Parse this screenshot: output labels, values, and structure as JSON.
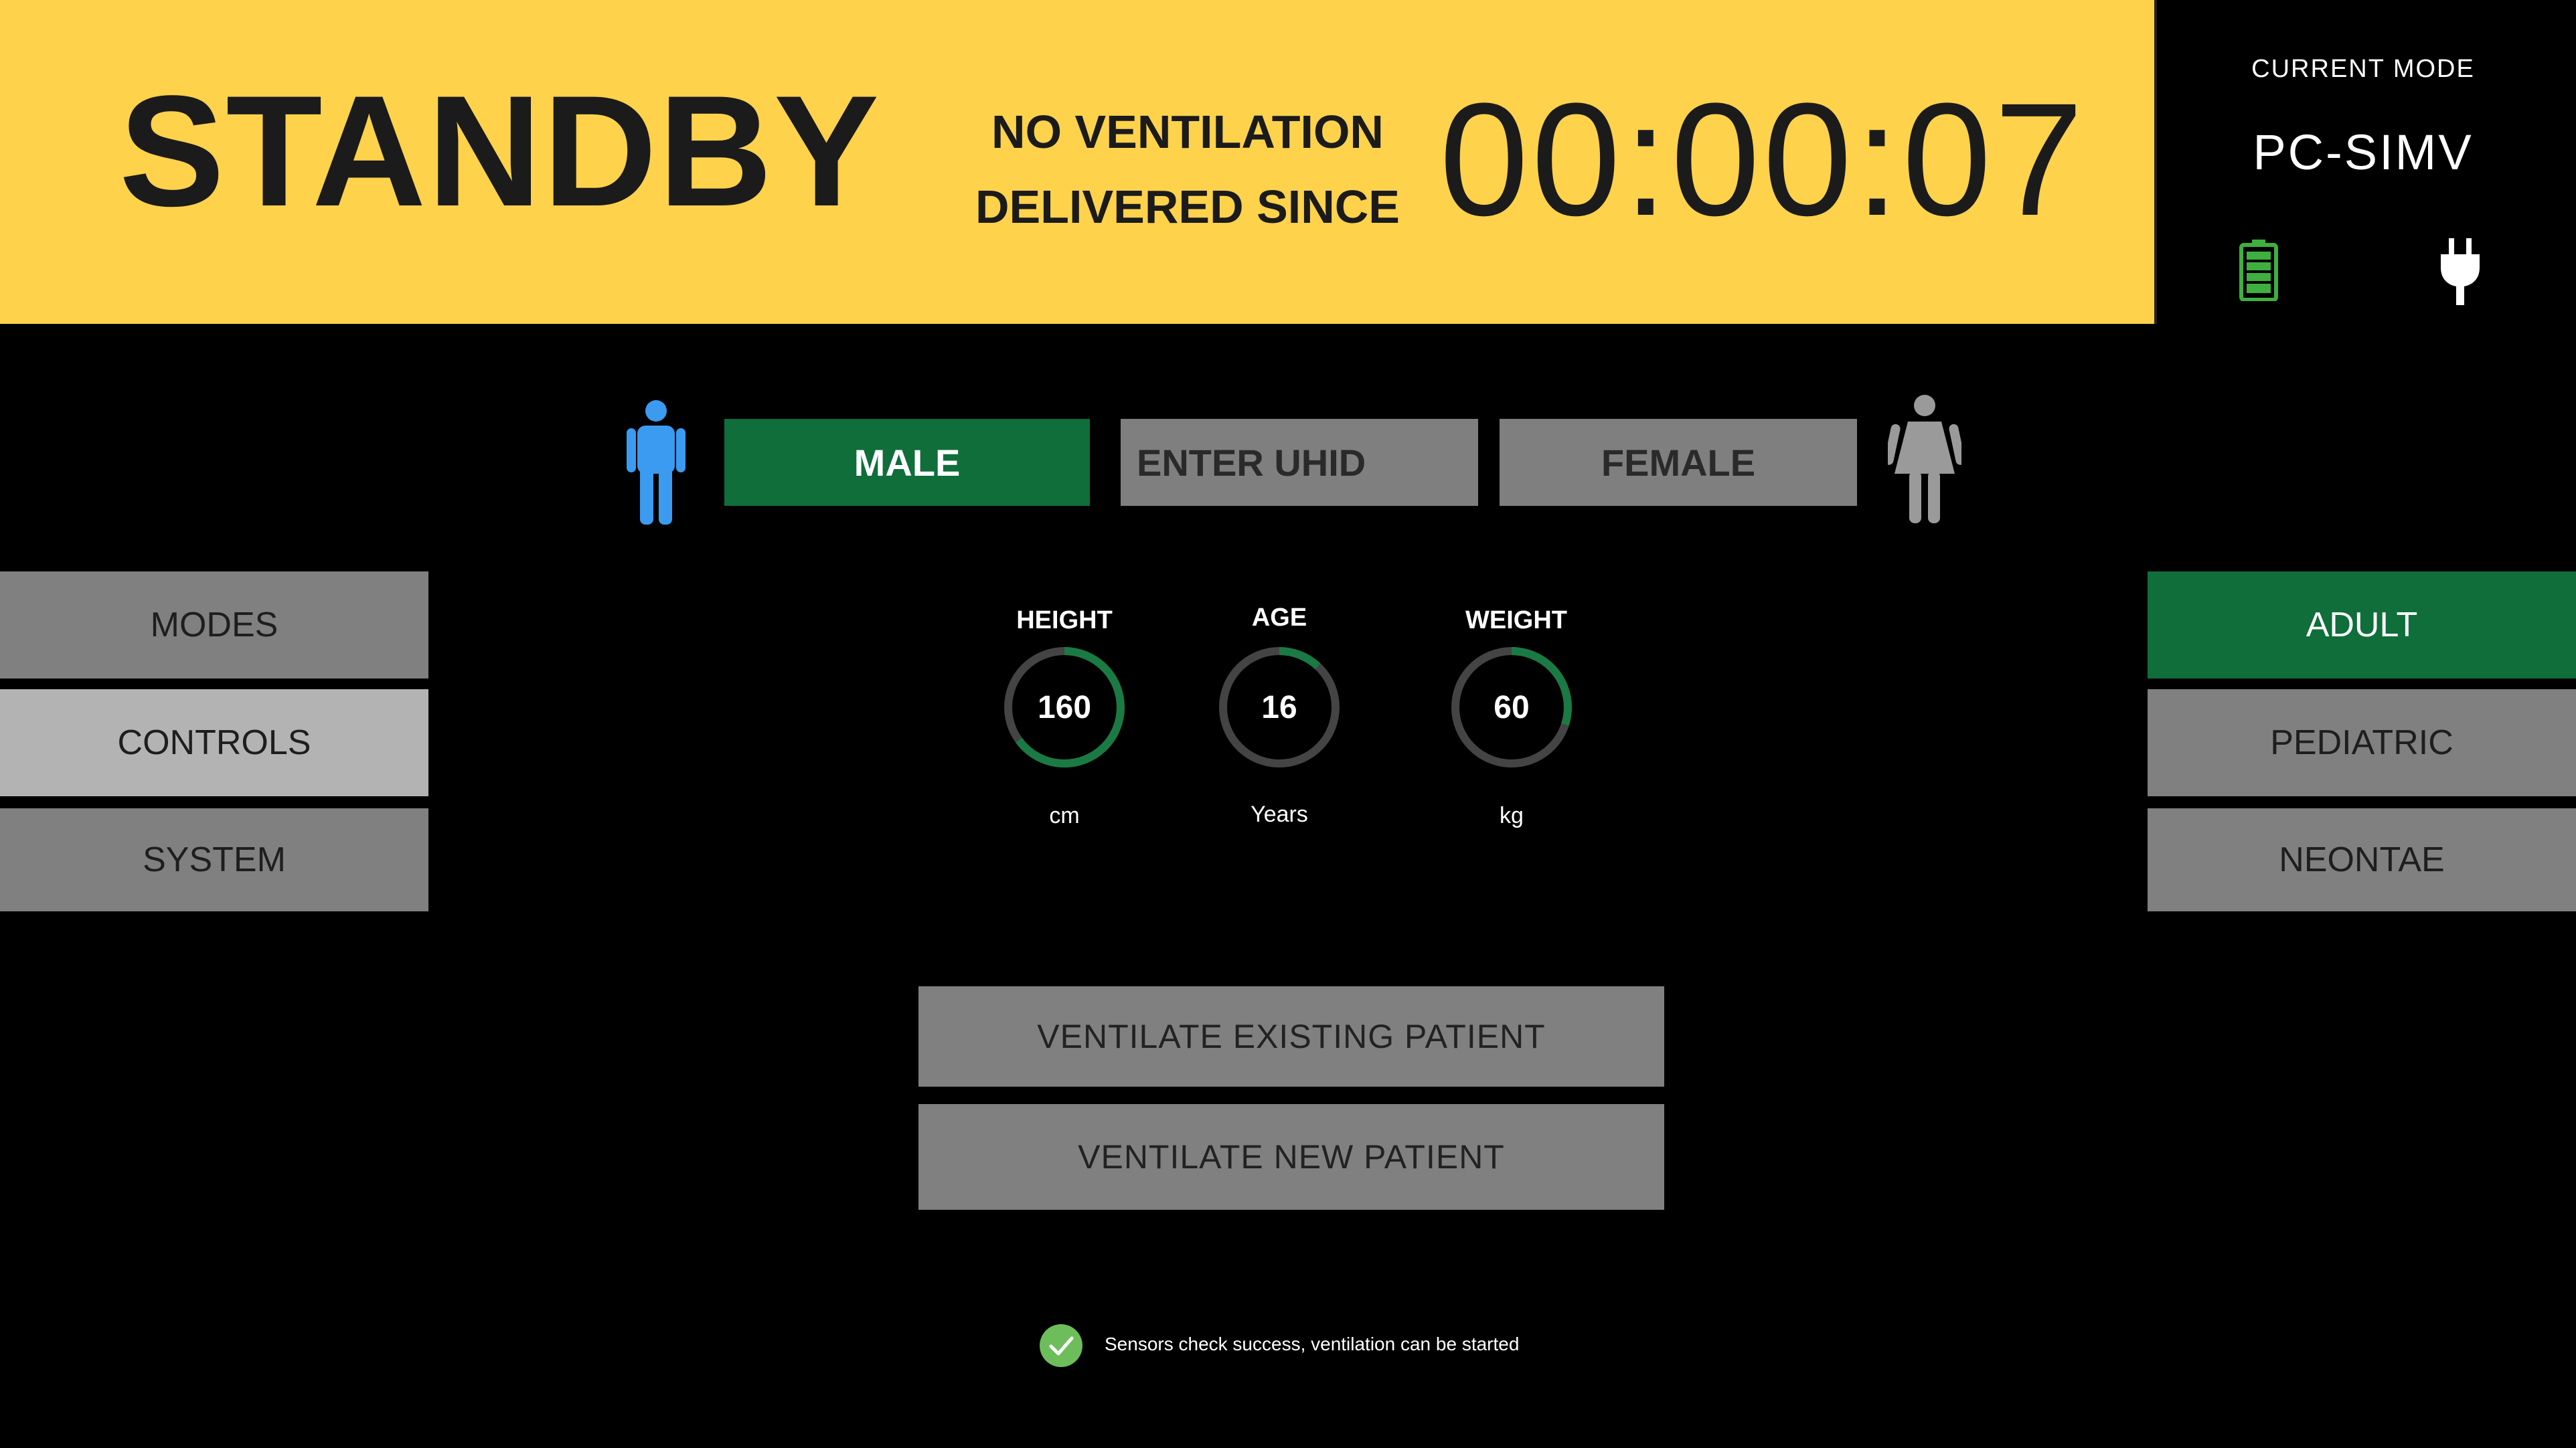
{
  "header": {
    "status": "STANDBY",
    "no_vent_line1": "NO VENTILATION",
    "no_vent_line2": "DELIVERED SINCE",
    "elapsed": "00:00:07",
    "banner_color": "#FFD24C"
  },
  "mode_panel": {
    "label": "CURRENT MODE",
    "value": "PC-SIMV",
    "battery_icon": "battery-full-icon",
    "power_icon": "power-plug-icon",
    "battery_color": "#3FAF3F"
  },
  "patient": {
    "male_label": "MALE",
    "uhid_placeholder": "ENTER UHID",
    "female_label": "FEMALE",
    "selected_gender": "MALE",
    "male_icon_color": "#3A9BF0",
    "female_icon_color": "#9a9a9a"
  },
  "left_nav": {
    "items": [
      {
        "label": "MODES"
      },
      {
        "label": "CONTROLS",
        "active": true
      },
      {
        "label": "SYSTEM"
      }
    ]
  },
  "right_nav": {
    "items": [
      {
        "label": "ADULT",
        "selected": true
      },
      {
        "label": "PEDIATRIC"
      },
      {
        "label": "NEONTAE"
      }
    ]
  },
  "dials": [
    {
      "label": "HEIGHT",
      "value": "160",
      "unit": "cm",
      "fill": 0.65
    },
    {
      "label": "AGE",
      "value": "16",
      "unit": "Years",
      "fill": 0.12
    },
    {
      "label": "WEIGHT",
      "value": "60",
      "unit": "kg",
      "fill": 0.3
    }
  ],
  "actions": {
    "existing_label": "VENTILATE EXISTING PATIENT",
    "new_label": "VENTILATE NEW PATIENT"
  },
  "status": {
    "icon": "check-circle-icon",
    "message": "Sensors check success, ventilation can be started",
    "color": "#6DBE5A"
  },
  "colors": {
    "selected_green": "#0F6E3A",
    "button_gray": "#808080"
  }
}
